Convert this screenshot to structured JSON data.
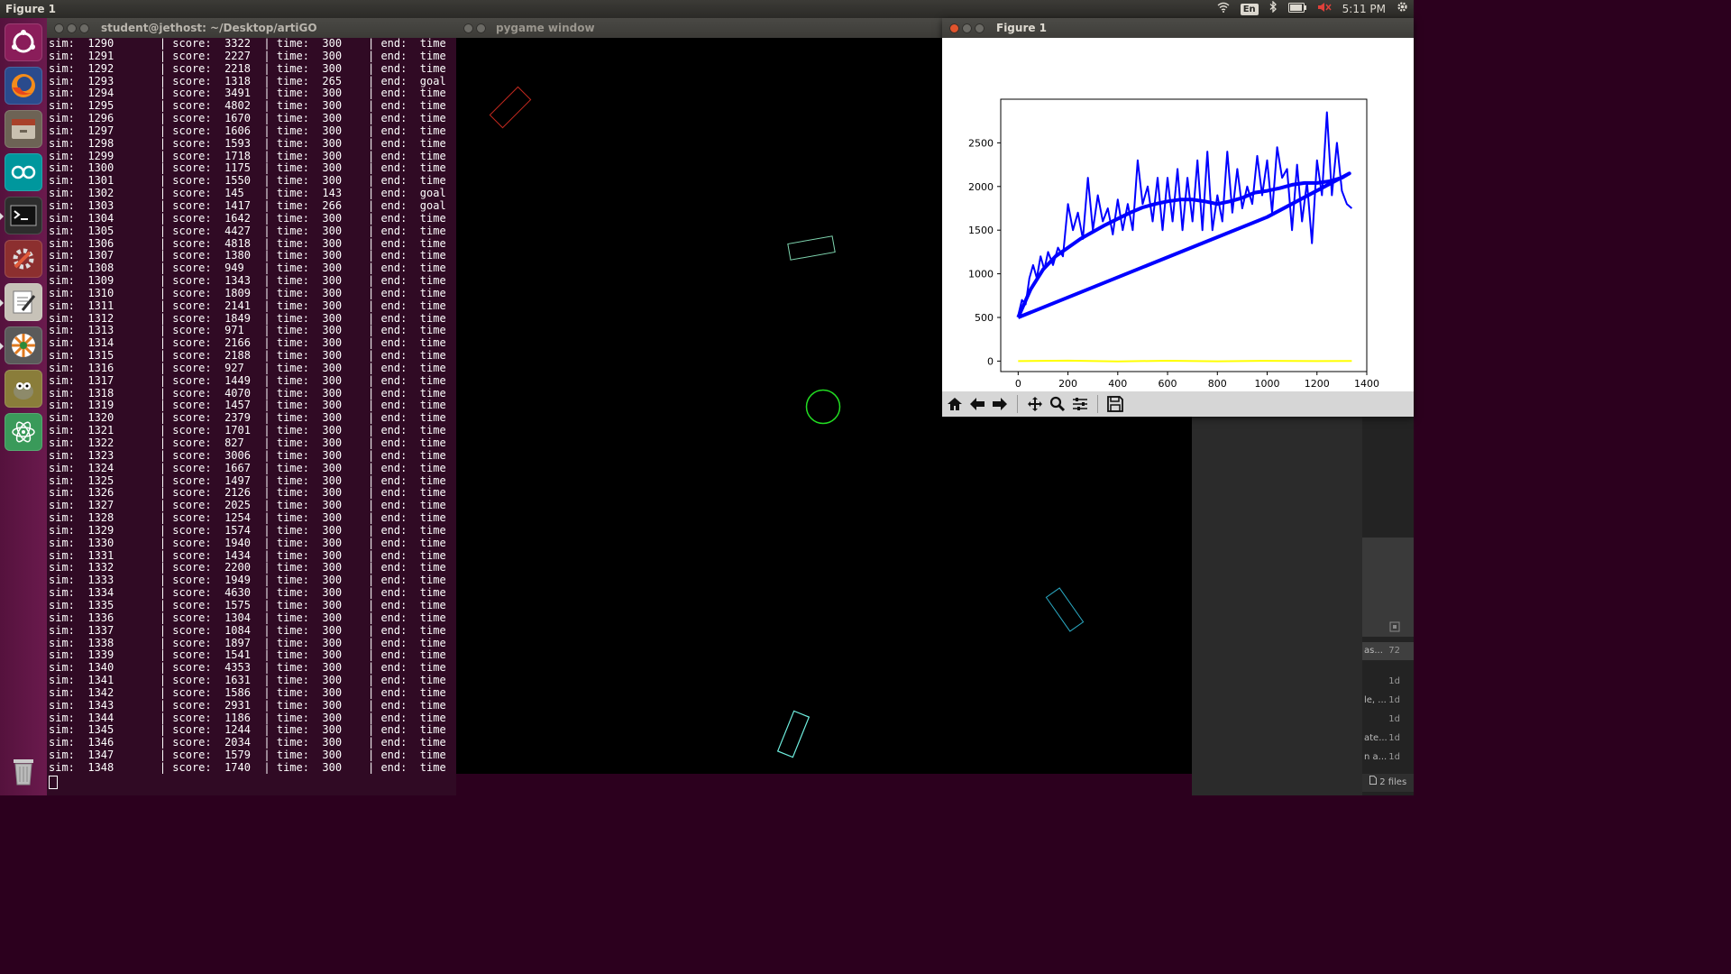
{
  "topbar": {
    "app_title": "Figure 1",
    "lang": "En",
    "clock": "5:11 PM"
  },
  "launcher": {
    "items": [
      "ubuntu-icon",
      "firefox-icon",
      "files-icon",
      "arduino-icon",
      "terminal-icon",
      "settings-icon",
      "text-editor-icon",
      "wheel-icon",
      "gimp-icon",
      "atom-icon"
    ]
  },
  "terminal": {
    "title": "student@jethost: ~/Desktop/artiGO",
    "lines": [
      "sim:  1290       | score:  3322  | time:  300    | end:  time",
      "sim:  1291       | score:  2227  | time:  300    | end:  time",
      "sim:  1292       | score:  2218  | time:  300    | end:  time",
      "sim:  1293       | score:  1318  | time:  265    | end:  goal",
      "sim:  1294       | score:  3491  | time:  300    | end:  time",
      "sim:  1295       | score:  4802  | time:  300    | end:  time",
      "sim:  1296       | score:  1670  | time:  300    | end:  time",
      "sim:  1297       | score:  1606  | time:  300    | end:  time",
      "sim:  1298       | score:  1593  | time:  300    | end:  time",
      "sim:  1299       | score:  1718  | time:  300    | end:  time",
      "sim:  1300       | score:  1175  | time:  300    | end:  time",
      "sim:  1301       | score:  1550  | time:  300    | end:  time",
      "sim:  1302       | score:  145   | time:  143    | end:  goal",
      "sim:  1303       | score:  1417  | time:  266    | end:  goal",
      "sim:  1304       | score:  1642  | time:  300    | end:  time",
      "sim:  1305       | score:  4427  | time:  300    | end:  time",
      "sim:  1306       | score:  4818  | time:  300    | end:  time",
      "sim:  1307       | score:  1380  | time:  300    | end:  time",
      "sim:  1308       | score:  949   | time:  300    | end:  time",
      "sim:  1309       | score:  1343  | time:  300    | end:  time",
      "sim:  1310       | score:  1809  | time:  300    | end:  time",
      "sim:  1311       | score:  2141  | time:  300    | end:  time",
      "sim:  1312       | score:  1849  | time:  300    | end:  time",
      "sim:  1313       | score:  971   | time:  300    | end:  time",
      "sim:  1314       | score:  2166  | time:  300    | end:  time",
      "sim:  1315       | score:  2188  | time:  300    | end:  time",
      "sim:  1316       | score:  927   | time:  300    | end:  time",
      "sim:  1317       | score:  1449  | time:  300    | end:  time",
      "sim:  1318       | score:  4070  | time:  300    | end:  time",
      "sim:  1319       | score:  1457  | time:  300    | end:  time",
      "sim:  1320       | score:  2379  | time:  300    | end:  time",
      "sim:  1321       | score:  1701  | time:  300    | end:  time",
      "sim:  1322       | score:  827   | time:  300    | end:  time",
      "sim:  1323       | score:  3006  | time:  300    | end:  time",
      "sim:  1324       | score:  1667  | time:  300    | end:  time",
      "sim:  1325       | score:  1497  | time:  300    | end:  time",
      "sim:  1326       | score:  2126  | time:  300    | end:  time",
      "sim:  1327       | score:  2025  | time:  300    | end:  time",
      "sim:  1328       | score:  1254  | time:  300    | end:  time",
      "sim:  1329       | score:  1574  | time:  300    | end:  time",
      "sim:  1330       | score:  1940  | time:  300    | end:  time",
      "sim:  1331       | score:  1434  | time:  300    | end:  time",
      "sim:  1332       | score:  2200  | time:  300    | end:  time",
      "sim:  1333       | score:  1949  | time:  300    | end:  time",
      "sim:  1334       | score:  4630  | time:  300    | end:  time",
      "sim:  1335       | score:  1575  | time:  300    | end:  time",
      "sim:  1336       | score:  1304  | time:  300    | end:  time",
      "sim:  1337       | score:  1084  | time:  300    | end:  time",
      "sim:  1338       | score:  1897  | time:  300    | end:  time",
      "sim:  1339       | score:  1541  | time:  300    | end:  time",
      "sim:  1340       | score:  4353  | time:  300    | end:  time",
      "sim:  1341       | score:  1631  | time:  300    | end:  time",
      "sim:  1342       | score:  1586  | time:  300    | end:  time",
      "sim:  1343       | score:  2931  | time:  300    | end:  time",
      "sim:  1344       | score:  1186  | time:  300    | end:  time",
      "sim:  1345       | score:  1244  | time:  300    | end:  time",
      "sim:  1346       | score:  2034  | time:  300    | end:  time",
      "sim:  1347       | score:  1579  | time:  300    | end:  time",
      "sim:  1348       | score:  1740  | time:  300    | end:  time"
    ]
  },
  "pygame": {
    "title": "pygame window",
    "shape_colors": {
      "red": "#c0281e",
      "green": "#22dd22",
      "teal": "#7fd6b0",
      "cyan": "#2aa7c0",
      "aqua": "#6ff0e0"
    }
  },
  "editor": {
    "items": [
      {
        "label": "as...",
        "age": "72"
      },
      {
        "label": "",
        "age": "1d"
      },
      {
        "label": "le, ...",
        "age": "1d"
      },
      {
        "label": "",
        "age": "1d"
      },
      {
        "label": "ate...",
        "age": "1d"
      },
      {
        "label": "n a...",
        "age": "1d"
      }
    ],
    "files_badge": "2 files"
  },
  "figure": {
    "title": "Figure 1",
    "toolbar": [
      "home-icon",
      "back-icon",
      "forward-icon",
      "pan-icon",
      "zoom-icon",
      "configure-icon",
      "save-icon"
    ]
  },
  "chart_data": {
    "type": "line",
    "title": "",
    "xlabel": "",
    "ylabel": "",
    "xlim": [
      -70,
      1400
    ],
    "ylim": [
      -120,
      3000
    ],
    "xticks": [
      0,
      200,
      400,
      600,
      800,
      1000,
      1200,
      1400
    ],
    "yticks": [
      0,
      500,
      1000,
      1500,
      2000,
      2500
    ],
    "grid": false,
    "series": [
      {
        "color": "#0000ff",
        "width": 2,
        "x": [
          0,
          15,
          30,
          45,
          60,
          75,
          90,
          105,
          120,
          140,
          160,
          180,
          200,
          220,
          240,
          260,
          280,
          300,
          320,
          340,
          360,
          380,
          400,
          420,
          440,
          460,
          480,
          500,
          520,
          540,
          560,
          580,
          600,
          620,
          640,
          660,
          680,
          700,
          720,
          740,
          760,
          780,
          800,
          820,
          840,
          860,
          880,
          900,
          920,
          940,
          960,
          980,
          1000,
          1020,
          1040,
          1060,
          1080,
          1100,
          1120,
          1140,
          1160,
          1180,
          1200,
          1220,
          1240,
          1260,
          1280,
          1300,
          1320,
          1340
        ],
        "y": [
          520,
          700,
          650,
          950,
          1100,
          950,
          1200,
          1050,
          1250,
          1100,
          1300,
          1200,
          1800,
          1500,
          1700,
          1400,
          2100,
          1500,
          1900,
          1600,
          1750,
          1450,
          1850,
          1500,
          1800,
          1500,
          2300,
          1800,
          2000,
          1600,
          2100,
          1500,
          2100,
          1600,
          2200,
          1500,
          2100,
          1600,
          2300,
          1500,
          2400,
          1500,
          1900,
          1600,
          2400,
          1700,
          2200,
          1750,
          2000,
          1800,
          2350,
          1900,
          2300,
          1700,
          2450,
          2100,
          2200,
          1500,
          2250,
          1600,
          2050,
          1350,
          2300,
          1900,
          2850,
          1900,
          2500,
          1950,
          1800,
          1750
        ]
      },
      {
        "color": "#0000ff",
        "width": 4,
        "x": [
          0,
          50,
          100,
          150,
          200,
          250,
          300,
          350,
          400,
          450,
          500,
          550,
          600,
          650,
          700,
          750,
          800,
          850,
          900,
          950,
          1000,
          1050,
          1100,
          1150,
          1200,
          1250,
          1300,
          1330,
          1000,
          0
        ],
        "y": [
          500,
          820,
          1050,
          1200,
          1300,
          1400,
          1480,
          1560,
          1630,
          1700,
          1760,
          1800,
          1830,
          1850,
          1850,
          1830,
          1800,
          1830,
          1870,
          1930,
          1950,
          1980,
          2020,
          2040,
          2040,
          2060,
          2100,
          2150,
          1650,
          500
        ]
      },
      {
        "color": "#ffff00",
        "width": 2,
        "x": [
          0,
          200,
          400,
          600,
          800,
          1000,
          1200,
          1340
        ],
        "y": [
          0,
          5,
          -3,
          4,
          -2,
          3,
          0,
          2
        ]
      }
    ]
  }
}
